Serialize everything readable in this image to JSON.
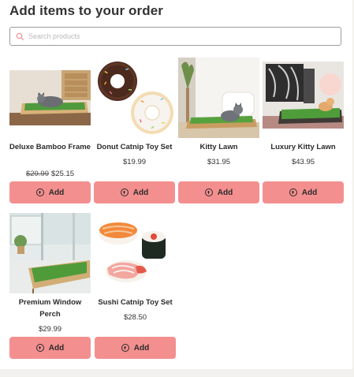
{
  "header": {
    "title": "Add items to your order"
  },
  "search": {
    "placeholder": "Search products",
    "icon": "search-icon",
    "icon_color": "#f48f8f"
  },
  "button_color": "#f48f8f",
  "products": [
    {
      "name": "Deluxe Bamboo Frame",
      "old_price": "$29.99",
      "price": "$25.15",
      "button_label": "Add"
    },
    {
      "name": "Donut Catnip Toy Set",
      "price": "$19.99",
      "button_label": "Add"
    },
    {
      "name": "Kitty Lawn",
      "price": "$31.95",
      "button_label": "Add"
    },
    {
      "name": "Luxury Kitty Lawn",
      "price": "$43.95",
      "button_label": "Add"
    },
    {
      "name": "Premium Window Perch",
      "price": "$29.99",
      "button_label": "Add"
    },
    {
      "name": "Sushi Catnip Toy Set",
      "price": "$28.50",
      "button_label": "Add"
    }
  ]
}
